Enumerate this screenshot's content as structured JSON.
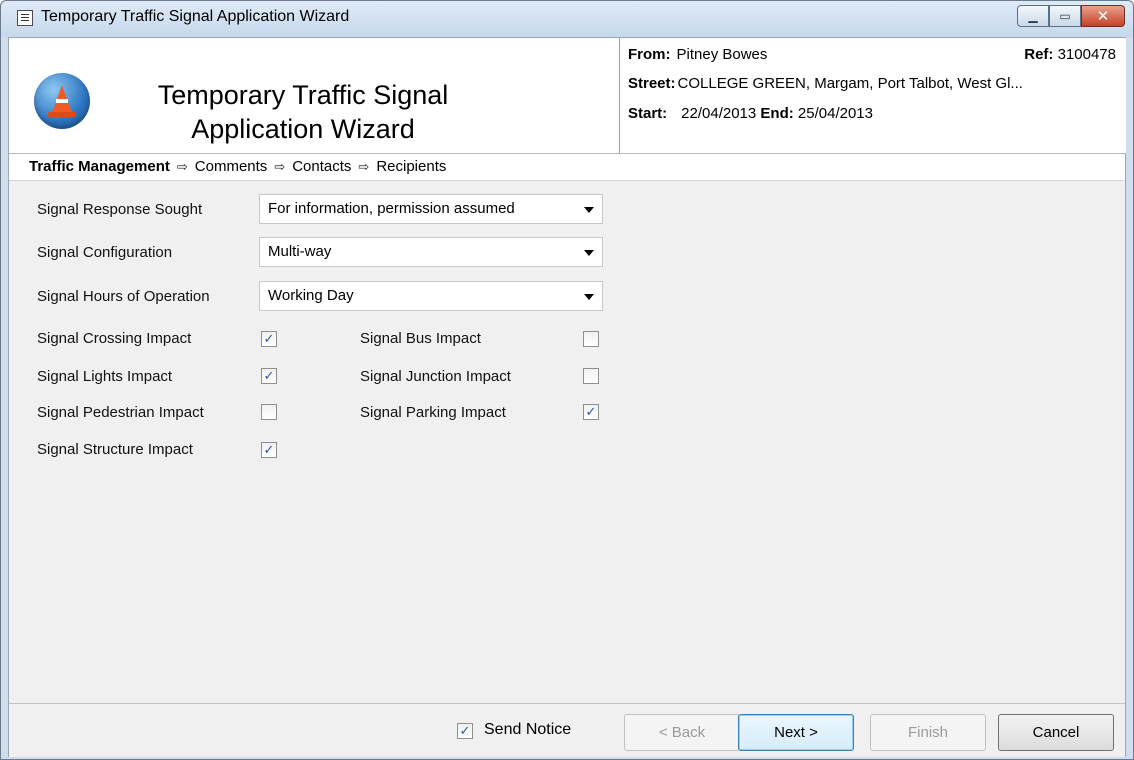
{
  "window": {
    "title": "Temporary Traffic Signal Application Wizard"
  },
  "header": {
    "title_line1": "Temporary Traffic Signal",
    "title_line2": "Application Wizard",
    "from_label": "From:",
    "from_value": "Pitney Bowes",
    "ref_label": "Ref:",
    "ref_value": "3100478",
    "street_label": "Street:",
    "street_value": "COLLEGE GREEN, Margam, Port Talbot, West Gl...",
    "start_label": "Start:",
    "start_value": "22/04/2013",
    "end_label": "End:",
    "end_value": "25/04/2013"
  },
  "breadcrumb": {
    "steps": [
      "Traffic Management",
      "Comments",
      "Contacts",
      "Recipients"
    ],
    "active_index": 0
  },
  "form": {
    "response_label": "Signal Response Sought",
    "response_value": "For information, permission assumed",
    "configuration_label": "Signal Configuration",
    "configuration_value": "Multi-way",
    "hours_label": "Signal Hours of Operation",
    "hours_value": "Working Day",
    "checks": {
      "crossing": {
        "label": "Signal Crossing Impact",
        "checked": true
      },
      "lights": {
        "label": "Signal Lights Impact",
        "checked": true
      },
      "pedestrian": {
        "label": "Signal Pedestrian Impact",
        "checked": false
      },
      "structure": {
        "label": "Signal Structure Impact",
        "checked": true
      },
      "bus": {
        "label": "Signal Bus Impact",
        "checked": false
      },
      "junction": {
        "label": "Signal Junction Impact",
        "checked": false
      },
      "parking": {
        "label": "Signal Parking Impact",
        "checked": true
      }
    }
  },
  "footer": {
    "send_notice_label": "Send Notice",
    "send_notice_checked": true,
    "back_label": "< Back",
    "next_label": "Next >",
    "finish_label": "Finish",
    "cancel_label": "Cancel"
  },
  "colors": {
    "title_bar": "#cfdded",
    "check_mark": "#2b55a5",
    "close_button": "#c7432a"
  }
}
